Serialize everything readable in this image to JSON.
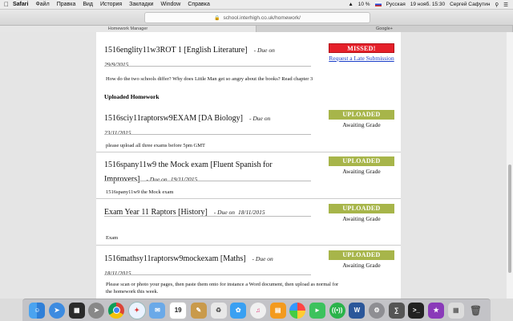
{
  "menubar": {
    "apple": "",
    "items": [
      "Safari",
      "Файл",
      "Правка",
      "Вид",
      "История",
      "Закладки",
      "Window",
      "Справка"
    ],
    "battery": "10 %",
    "language": "Русская",
    "datetime": "19 нояб.  15:30",
    "user": "Сергей Сафутин"
  },
  "browser": {
    "url": "school.interhigh.co.uk/homework/",
    "tabs": [
      "Homework Manager",
      "Google+"
    ]
  },
  "homework": [
    {
      "title": "1516englity11w3ROT 1 [English Literature]",
      "due_label": "- Due on",
      "due_date": "29/9/2015",
      "status": "MISSED!",
      "action": "Request a Late Submission",
      "note": "How do the two schools differ? Why does Little Man get so angry about the books? Read chapter 3"
    }
  ],
  "section_title": "Uploaded Homework",
  "uploaded": [
    {
      "title": "1516sciy11raptorsw9EXAM [DA Biology]",
      "due_label": "- Due on",
      "due_date": "23/11/2015",
      "status": "UPLOADED",
      "sub": "Awaiting Grade",
      "note": "please upload all three exams before 5pm GMT"
    },
    {
      "title_line1": "1516spany11w9 the Mock exam [Fluent Spanish for",
      "title_line2": "Improvers]",
      "due_label": "- Due on",
      "due_date": "19/11/2015",
      "status": "UPLOADED",
      "sub": "Awaiting Grade",
      "note": "1516spany11w9 the Mock exam"
    },
    {
      "title": "Exam Year 11 Raptors [History]",
      "due_label": "- Due on",
      "due_date": "18/11/2015",
      "status": "UPLOADED",
      "sub": "Awaiting Grade",
      "note": "Exam"
    },
    {
      "title": "1516mathsy11raptorsw9mockexam [Maths]",
      "due_label": "- Due on",
      "due_date": "18/11/2015",
      "status": "UPLOADED",
      "sub": "Awaiting Grade",
      "note_line1": "Please scan or photo your pages, then paste them onto for instance a Word document, then upload as normal for",
      "note_line2": "the homework this week."
    }
  ],
  "dock": {
    "calendar_day": "19"
  },
  "colors": {
    "uploaded": "#a7b54a",
    "missed": "#e5202a",
    "link": "#1a3ec9"
  }
}
